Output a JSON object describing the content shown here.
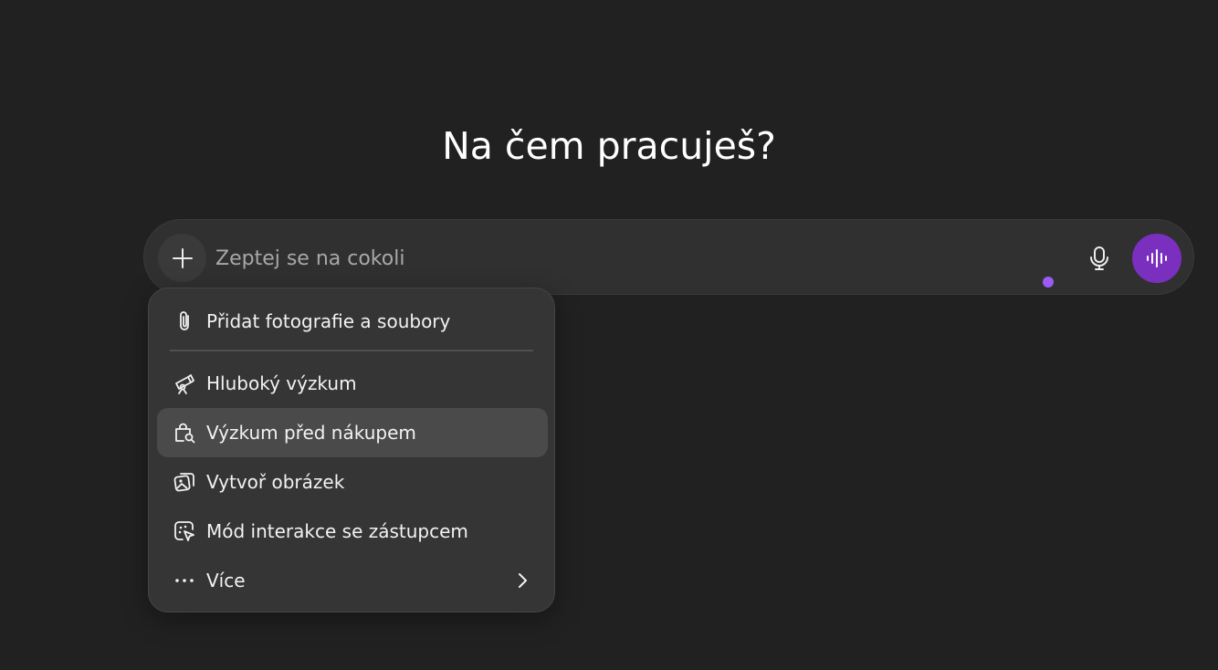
{
  "main": {
    "heading": "Na čem pracuješ?"
  },
  "composer": {
    "placeholder": "Zeptej se na cokoli",
    "plus_icon": "plus-icon",
    "mic_icon": "microphone-icon",
    "voice_icon": "voice-waveform-icon",
    "accent_color": "#7b2fbe",
    "status_dot_color": "#9a5cf5"
  },
  "menu": {
    "items": [
      {
        "label": "Přidat fotografie a soubory",
        "icon": "paperclip-icon"
      },
      {
        "label": "Hluboký výzkum",
        "icon": "telescope-icon"
      },
      {
        "label": "Výzkum před nákupem",
        "icon": "shopping-bag-search-icon"
      },
      {
        "label": "Vytvoř obrázek",
        "icon": "image-create-icon"
      },
      {
        "label": "Mód interakce se zástupcem",
        "icon": "agent-cursor-icon"
      },
      {
        "label": "Více",
        "icon": "more-dots-icon",
        "submenu_icon": "chevron-right-icon"
      }
    ],
    "highlighted_index": 2
  }
}
